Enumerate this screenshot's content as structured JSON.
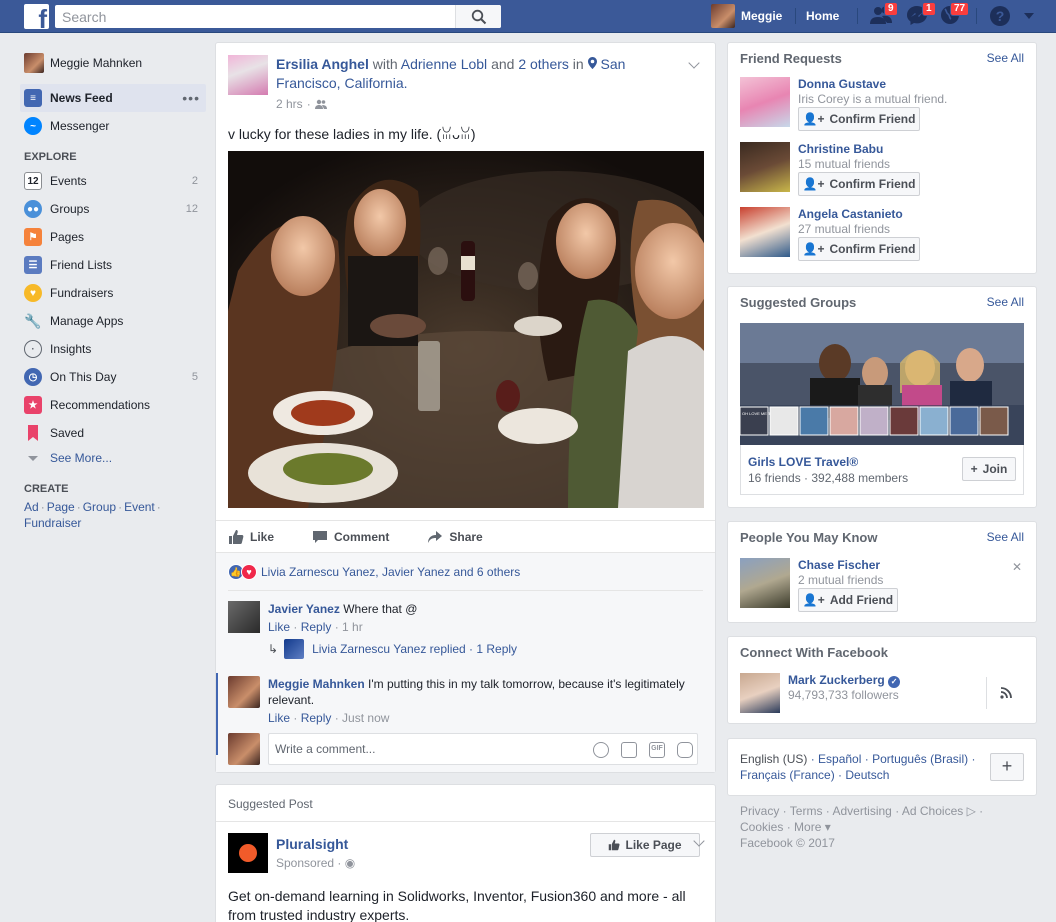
{
  "topbar": {
    "search_placeholder": "Search",
    "user_name": "Meggie",
    "home_label": "Home",
    "friend_requests_badge": "9",
    "messages_badge": "1",
    "notifications_badge": "77"
  },
  "leftnav": {
    "user": "Meggie Mahnken",
    "news_feed": "News Feed",
    "messenger": "Messenger",
    "explore_heading": "EXPLORE",
    "explore_items": [
      {
        "label": "Events",
        "count": "2",
        "icon": "calendar-icon"
      },
      {
        "label": "Groups",
        "count": "12",
        "icon": "groups-icon"
      },
      {
        "label": "Pages",
        "count": "",
        "icon": "flag-icon"
      },
      {
        "label": "Friend Lists",
        "count": "",
        "icon": "friend-list-icon"
      },
      {
        "label": "Fundraisers",
        "count": "",
        "icon": "fundraiser-icon"
      },
      {
        "label": "Manage Apps",
        "count": "",
        "icon": "wrench-icon"
      },
      {
        "label": "Insights",
        "count": "",
        "icon": "insights-icon"
      },
      {
        "label": "On This Day",
        "count": "5",
        "icon": "clock-icon"
      },
      {
        "label": "Recommendations",
        "count": "",
        "icon": "star-icon"
      },
      {
        "label": "Saved",
        "count": "",
        "icon": "bookmark-icon"
      }
    ],
    "see_more": "See More...",
    "create_heading": "CREATE",
    "create_links": [
      "Ad",
      "Page",
      "Group",
      "Event",
      "Fundraiser"
    ]
  },
  "post": {
    "author": "Ersilia Anghel",
    "with_word": "with",
    "tagged": "Adrienne Lobl",
    "and_word": "and",
    "others": "2 others",
    "in_word": "in",
    "location": "San Francisco, California.",
    "time": "2 hrs",
    "text": "v lucky for these ladies in my life. (ꈍᴗꈍ)",
    "actions": {
      "like": "Like",
      "comment": "Comment",
      "share": "Share"
    },
    "reactions_text": "Livia Zarnescu Yanez, Javier Yanez and 6 others",
    "comments": [
      {
        "author": "Javier Yanez",
        "text": "Where that @",
        "like": "Like",
        "reply": "Reply",
        "time": "1 hr"
      },
      {
        "author": "Meggie Mahnken",
        "text": "I'm putting this in my talk tomorrow, because it's legitimately relevant.",
        "like": "Like",
        "reply": "Reply",
        "time": "Just now"
      }
    ],
    "reply_summary": "Livia Zarnescu Yanez replied · 1 Reply",
    "write_placeholder": "Write a comment..."
  },
  "suggested_post": {
    "heading": "Suggested Post",
    "page_name": "Pluralsight",
    "sponsored": "Sponsored ·",
    "like_page": "Like Page",
    "text": "Get on-demand learning in Solidworks, Inventor, Fusion360 and more - all from trusted industry experts."
  },
  "friend_requests": {
    "heading": "Friend Requests",
    "see_all": "See All",
    "items": [
      {
        "name": "Donna Gustave",
        "sub": "Iris Corey is a mutual friend.",
        "button": "Confirm Friend"
      },
      {
        "name": "Christine Babu",
        "sub": "15 mutual friends",
        "button": "Confirm Friend"
      },
      {
        "name": "Angela Castanieto",
        "sub": "27 mutual friends",
        "button": "Confirm Friend"
      }
    ]
  },
  "suggested_groups": {
    "heading": "Suggested Groups",
    "see_all": "See All",
    "name": "Girls LOVE Travel®",
    "sub": "16 friends · 392,488 members",
    "join": "Join",
    "banner_text": "OH LOVE ME TRAVEL"
  },
  "pymk": {
    "heading": "People You May Know",
    "see_all": "See All",
    "name": "Chase Fischer",
    "sub": "2 mutual friends",
    "button": "Add Friend"
  },
  "connect": {
    "heading": "Connect With Facebook",
    "name": "Mark Zuckerberg",
    "sub": "94,793,733 followers"
  },
  "languages": {
    "current": "English (US)",
    "others": [
      "Español",
      "Português (Brasil)",
      "Français (France)",
      "Deutsch"
    ]
  },
  "footer": {
    "links": [
      "Privacy",
      "Terms",
      "Advertising",
      "Ad Choices",
      "Cookies",
      "More"
    ],
    "copyright": "Facebook © 2017"
  },
  "colors": {
    "brand": "#3b5998",
    "link": "#365899",
    "badge": "#fa3e3e",
    "background": "#e9ebee"
  }
}
